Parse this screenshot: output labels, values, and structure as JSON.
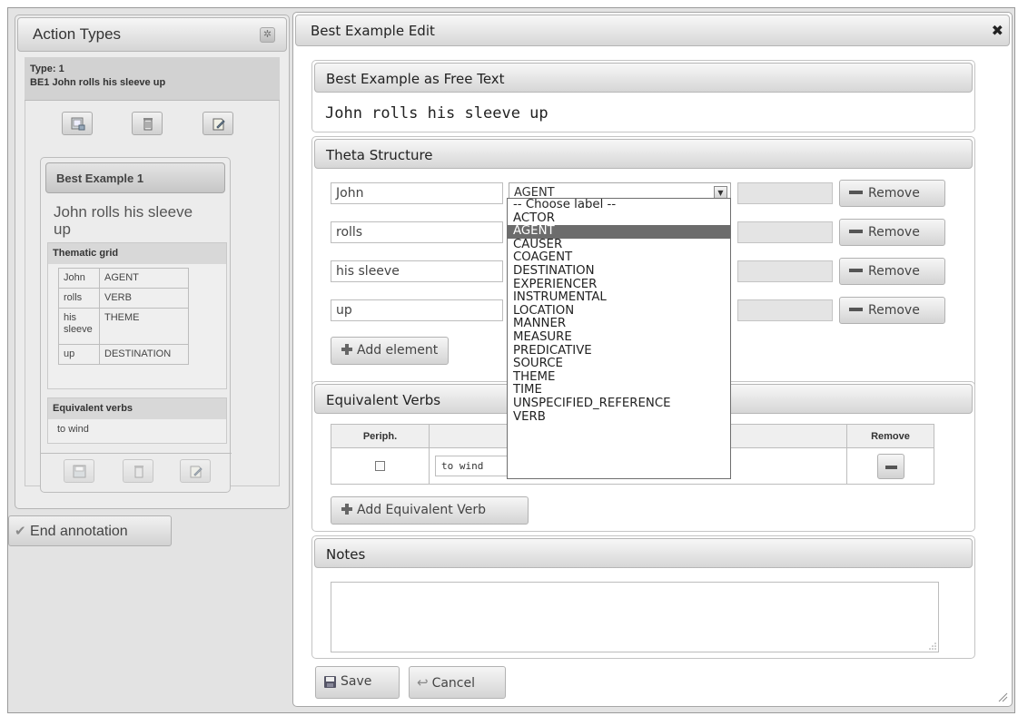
{
  "left_panel": {
    "title": "Action Types",
    "type_line": "Type: 1",
    "type_name": "BE1 John rolls his sleeve up",
    "best_example": {
      "header": "Best Example 1",
      "text": "John rolls his sleeve up",
      "thematic_grid_title": "Thematic grid",
      "grid": [
        {
          "word": "John",
          "role": "AGENT"
        },
        {
          "word": "rolls",
          "role": "VERB"
        },
        {
          "word": "his sleeve",
          "role": "THEME"
        },
        {
          "word": "up",
          "role": "DESTINATION"
        }
      ],
      "equivalent_verbs_title": "Equivalent verbs",
      "equivalent_verbs": [
        "to wind"
      ]
    },
    "end_annotation_label": "End annotation"
  },
  "dialog": {
    "title": "Best Example Edit",
    "close_symbol": "✖",
    "free_text_section": {
      "header": "Best Example as Free Text",
      "text": "John rolls his sleeve up"
    },
    "theta_section": {
      "header": "Theta Structure",
      "rows": [
        {
          "element": "John",
          "label": "AGENT"
        },
        {
          "element": "rolls",
          "label": ""
        },
        {
          "element": "his sleeve",
          "label": ""
        },
        {
          "element": "up",
          "label": ""
        }
      ],
      "remove_label": "Remove",
      "add_element_label": "Add element"
    },
    "label_dropdown": {
      "selected": "AGENT",
      "options": [
        "-- Choose label --",
        "ACTOR",
        "AGENT",
        "CAUSER",
        "COAGENT",
        "DESTINATION",
        "EXPERIENCER",
        "INSTRUMENTAL",
        "LOCATION",
        "MANNER",
        "MEASURE",
        "PREDICATIVE",
        "SOURCE",
        "THEME",
        "TIME",
        "UNSPECIFIED_REFERENCE",
        "VERB"
      ]
    },
    "equivalent_section": {
      "header": "Equivalent Verbs",
      "columns": {
        "periph": "Periph.",
        "verb": "",
        "remove": "Remove"
      },
      "rows": [
        {
          "periph": false,
          "verb": "to wind"
        }
      ],
      "add_label": "Add Equivalent Verb"
    },
    "notes_section": {
      "header": "Notes",
      "value": ""
    },
    "save_label": "Save",
    "cancel_label": "Cancel"
  },
  "colors": {
    "selected_option_bg": "#6c6c6c",
    "panel_bg": "#e3e3e3"
  }
}
